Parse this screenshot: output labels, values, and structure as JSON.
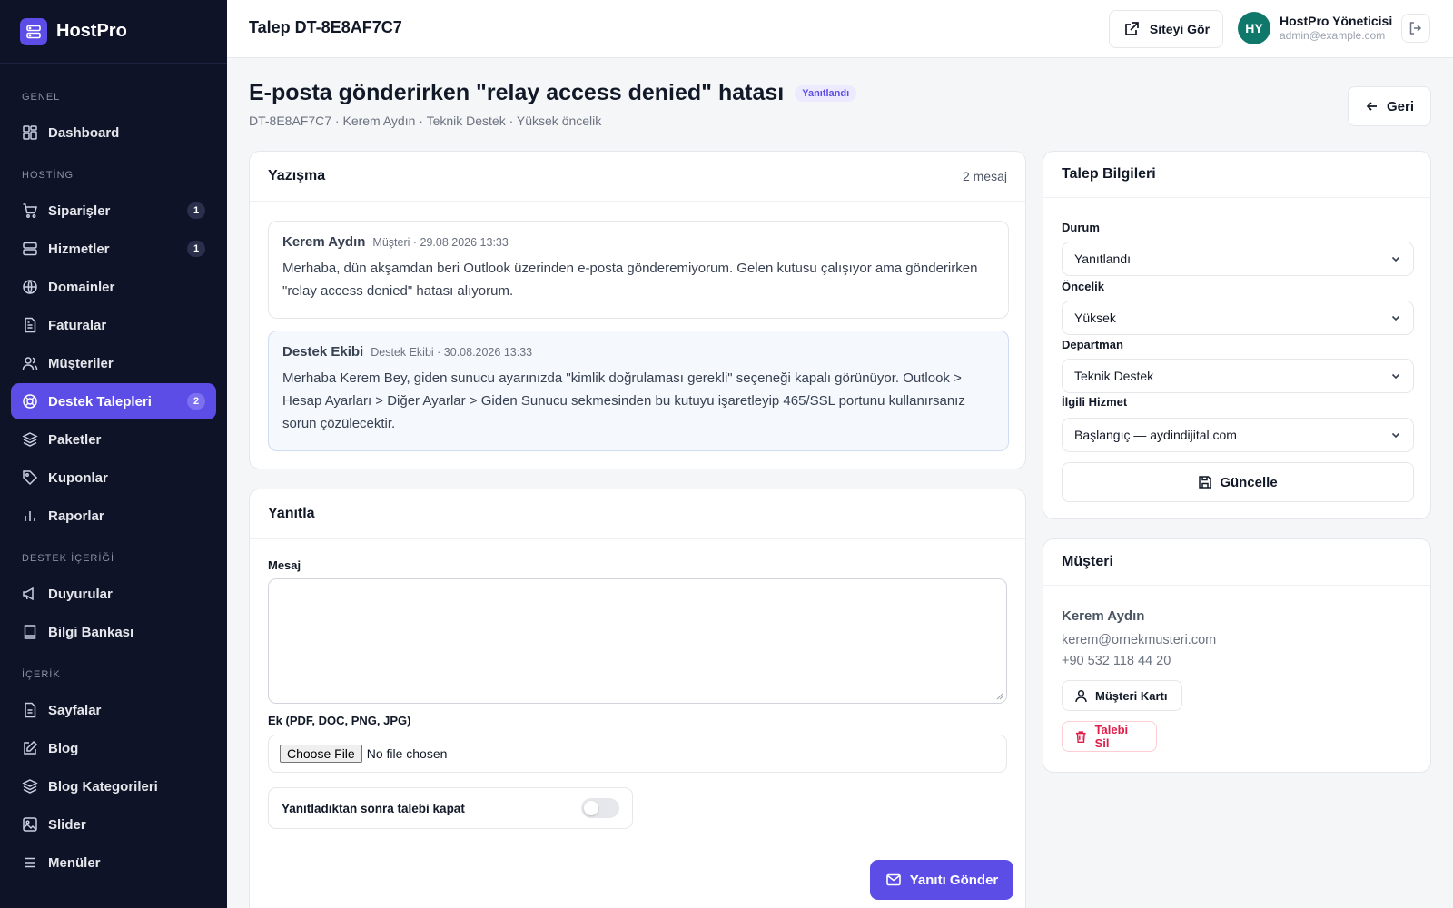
{
  "brand": {
    "name": "HostPro"
  },
  "sidebar": {
    "sections": {
      "genel": "GENEL",
      "hosting": "HOSTİNG",
      "destek": "DESTEK İÇERİĞİ",
      "icerik": "İÇERİK"
    },
    "items": {
      "dashboard": {
        "label": "Dashboard"
      },
      "siparisler": {
        "label": "Siparişler",
        "badge": "1"
      },
      "hizmetler": {
        "label": "Hizmetler",
        "badge": "1"
      },
      "domainler": {
        "label": "Domainler"
      },
      "faturalar": {
        "label": "Faturalar"
      },
      "musteriler": {
        "label": "Müşteriler"
      },
      "destek": {
        "label": "Destek Talepleri",
        "badge": "2"
      },
      "paketler": {
        "label": "Paketler"
      },
      "kuponlar": {
        "label": "Kuponlar"
      },
      "raporlar": {
        "label": "Raporlar"
      },
      "duyurular": {
        "label": "Duyurular"
      },
      "bilgi": {
        "label": "Bilgi Bankası"
      },
      "sayfalar": {
        "label": "Sayfalar"
      },
      "blog": {
        "label": "Blog"
      },
      "blogkat": {
        "label": "Blog Kategorileri"
      },
      "slider": {
        "label": "Slider"
      },
      "menuler": {
        "label": "Menüler"
      }
    }
  },
  "header": {
    "title": "Talep DT-8E8AF7C7",
    "view_site": "Siteyi Gör",
    "avatar_initials": "HY",
    "user_name": "HostPro Yöneticisi",
    "user_email": "admin@example.com"
  },
  "ticket": {
    "subject": "E-posta gönderirken \"relay access denied\" hatası",
    "status": "Yanıtlandı",
    "meta": "DT-8E8AF7C7 · Kerem Aydın · Teknik Destek · Yüksek öncelik",
    "back": "Geri"
  },
  "conversation": {
    "title": "Yazışma",
    "count": "2 mesaj",
    "messages": [
      {
        "author": "Kerem Aydın",
        "meta": "Müşteri · 29.08.2026 13:33",
        "body": "Merhaba, dün akşamdan beri Outlook üzerinden e-posta gönderemiyorum. Gelen kutusu çalışıyor ama gönderirken \"relay access denied\" hatası alıyorum."
      },
      {
        "author": "Destek Ekibi",
        "meta": "Destek Ekibi · 30.08.2026 13:33",
        "body": "Merhaba Kerem Bey, giden sunucu ayarınızda \"kimlik doğrulaması gerekli\" seçeneği kapalı görünüyor. Outlook > Hesap Ayarları > Diğer Ayarlar > Giden Sunucu sekmesinden bu kutuyu işaretleyip 465/SSL portunu kullanırsanız sorun çözülecektir."
      }
    ]
  },
  "reply": {
    "title": "Yanıtla",
    "message_label": "Mesaj",
    "attachment_label": "Ek (PDF, DOC, PNG, JPG)",
    "file_button": "Choose File",
    "file_status": "No file chosen",
    "close_toggle_label": "Yanıtladıktan sonra talebi kapat",
    "close_toggle_on": false,
    "send": "Yanıtı Gönder"
  },
  "info": {
    "title": "Talep Bilgileri",
    "status_label": "Durum",
    "status_value": "Yanıtlandı",
    "priority_label": "Öncelik",
    "priority_value": "Yüksek",
    "department_label": "Departman",
    "department_value": "Teknik Destek",
    "service_label": "İlgili Hizmet",
    "service_value": "Başlangıç — aydindijital.com",
    "update": "Güncelle"
  },
  "customer": {
    "title": "Müşteri",
    "name": "Kerem Aydın",
    "email": "kerem@ornekmusteri.com",
    "phone": "+90 532 118 44 20",
    "card_button": "Müşteri Kartı",
    "delete_button": "Talebi Sil"
  },
  "colors": {
    "accent": "#5b4de6",
    "sidebar_bg": "#0f1328",
    "danger": "#e11d48",
    "avatar": "#10786b"
  }
}
